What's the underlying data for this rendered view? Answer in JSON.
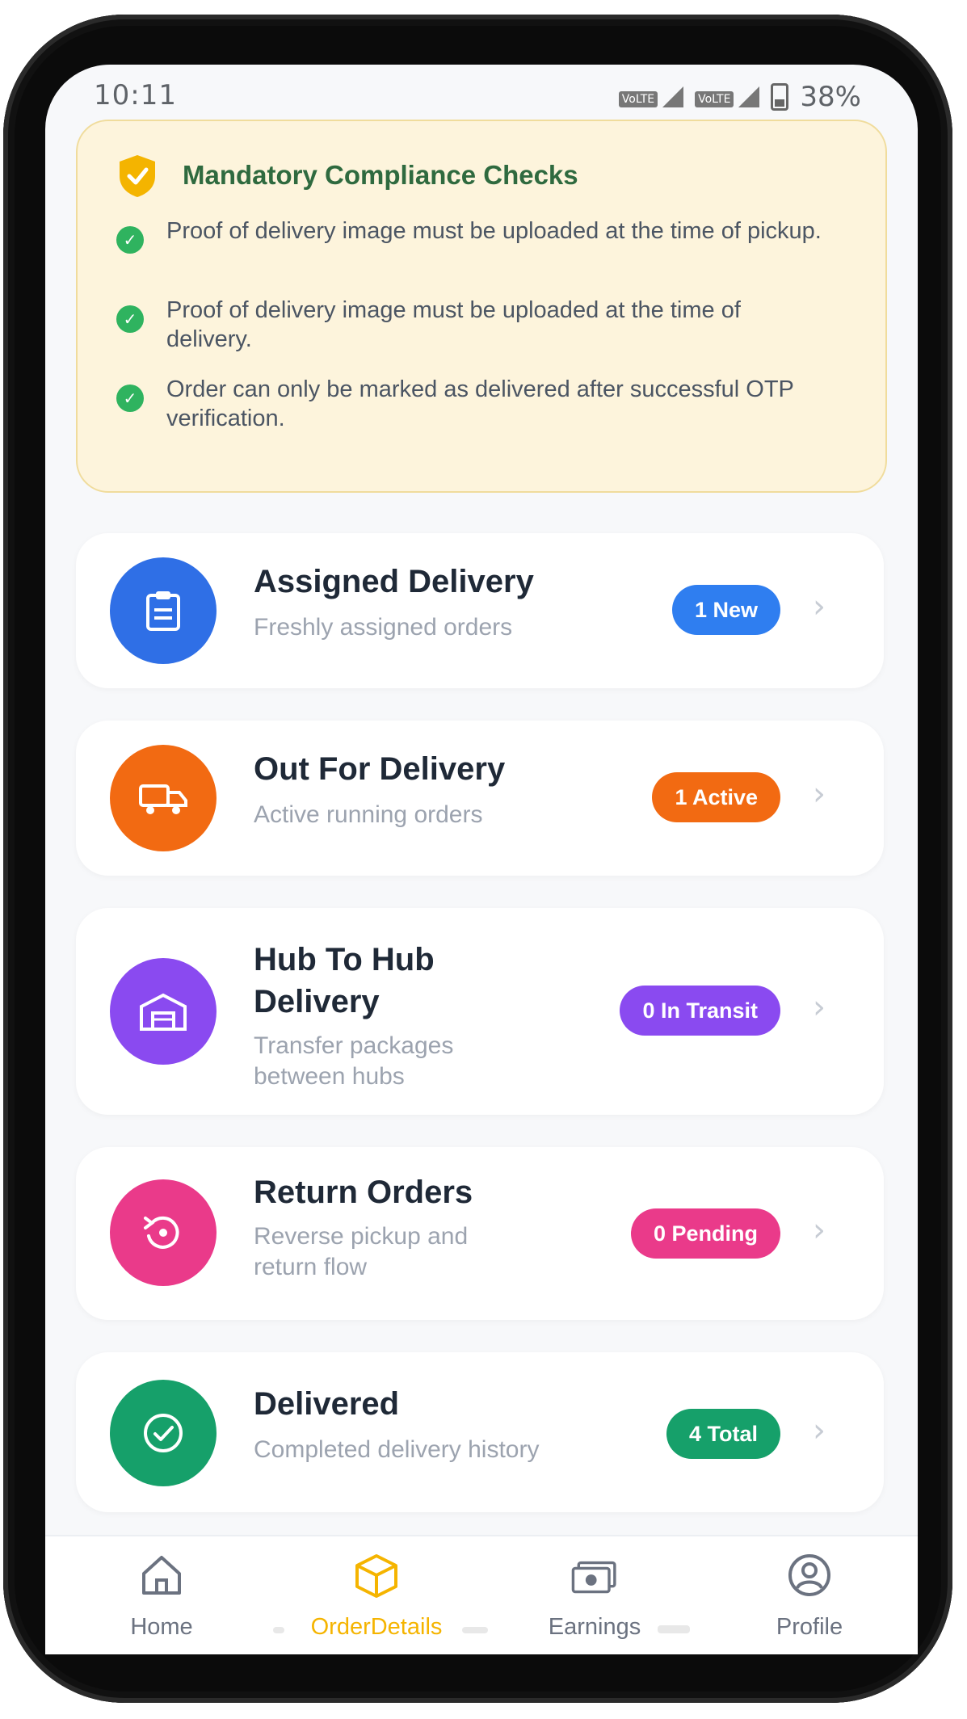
{
  "status_bar": {
    "time": "10:11",
    "battery": "38%"
  },
  "compliance": {
    "title": "Mandatory Compliance Checks",
    "items": [
      "Proof of delivery image must be uploaded at the time of pickup.",
      "Proof of delivery image must be uploaded at the time of delivery.",
      "Order can only be marked as delivered after successful OTP verification."
    ]
  },
  "cards": [
    {
      "title": "Assigned Delivery",
      "subtitle": "Freshly assigned orders",
      "badge": "1 New",
      "icon": "clipboard-icon",
      "color": "#2f6fe6"
    },
    {
      "title": "Out For Delivery",
      "subtitle": "Active running orders",
      "badge": "1 Active",
      "icon": "truck-icon",
      "color": "#f26a12"
    },
    {
      "title": "Hub To Hub Delivery",
      "subtitle": "Transfer packages between hubs",
      "badge": "0 In Transit",
      "icon": "warehouse-icon",
      "color": "#8a4af0"
    },
    {
      "title": "Return Orders",
      "subtitle": "Reverse pickup and return flow",
      "badge": "0 Pending",
      "icon": "return-icon",
      "color": "#ea3a8a"
    },
    {
      "title": "Delivered",
      "subtitle": "Completed delivery history",
      "badge": "4 Total",
      "icon": "check-circle-icon",
      "color": "#16a06a"
    }
  ],
  "bottom_nav": [
    {
      "label": "Home",
      "icon": "home-icon"
    },
    {
      "label": "OrderDetails",
      "icon": "box-icon",
      "active": true
    },
    {
      "label": "Earnings",
      "icon": "cash-icon"
    },
    {
      "label": "Profile",
      "icon": "user-icon"
    }
  ]
}
